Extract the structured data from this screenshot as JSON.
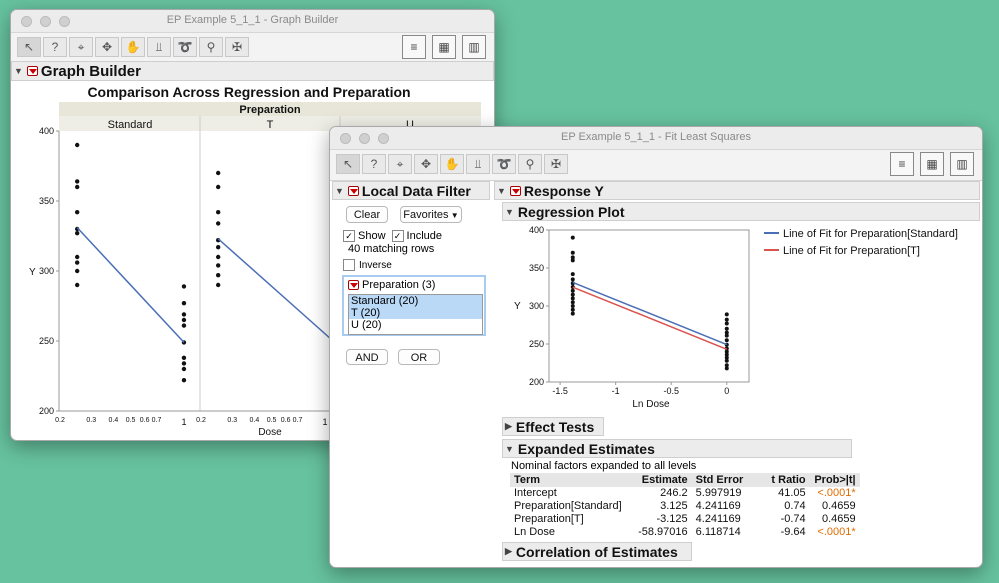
{
  "window1": {
    "title": "EP Example 5_1_1 - Graph Builder",
    "section_title": "Graph Builder",
    "chart_title": "Comparison Across Regression and Preparation",
    "group_header": "Preparation",
    "panels": [
      "Standard",
      "T",
      "U"
    ],
    "y_label": "Y",
    "x_label": "Dose"
  },
  "window2": {
    "title": "EP Example 5_1_1 - Fit Least Squares",
    "filter": {
      "title": "Local Data Filter",
      "clear_label": "Clear",
      "favorites_label": "Favorites",
      "show_label": "Show",
      "include_label": "Include",
      "matching_rows": "40 matching rows",
      "inverse_label": "Inverse",
      "column_label": "Preparation (3)",
      "levels": [
        "Standard (20)",
        "T (20)",
        "U (20)"
      ],
      "and_label": "AND",
      "or_label": "OR"
    },
    "response_title": "Response Y",
    "regression_title": "Regression Plot",
    "legend": [
      "Line of Fit for Preparation[Standard]",
      "Line of Fit for Preparation[T]"
    ],
    "plot_y_label": "Y",
    "plot_x_label": "Ln Dose",
    "effect_tests": "Effect Tests",
    "expanded_title": "Expanded Estimates",
    "expanded_note": "Nominal factors expanded to all levels",
    "table": {
      "headers": [
        "Term",
        "Estimate",
        "Std Error",
        "t Ratio",
        "Prob>|t|"
      ],
      "rows": [
        [
          "Intercept",
          "246.2",
          "5.997919",
          "41.05",
          "<.0001*"
        ],
        [
          "Preparation[Standard]",
          "3.125",
          "4.241169",
          "0.74",
          "0.4659"
        ],
        [
          "Preparation[T]",
          "-3.125",
          "4.241169",
          "-0.74",
          "0.4659"
        ],
        [
          "Ln Dose",
          "-58.97016",
          "6.118714",
          "-9.64",
          "<.0001*"
        ]
      ]
    },
    "correlation_title": "Correlation of Estimates"
  },
  "colors": {
    "standard_line": "#4a6fb5",
    "t_line": "#d9534f",
    "selection": "#b9d9f7",
    "significant": "#e06c00"
  },
  "chart_data": [
    {
      "type": "scatter",
      "title": "Comparison Across Regression and Preparation",
      "xlabel": "Dose",
      "ylabel": "Y",
      "xscale": "log",
      "xlim": [
        0.2,
        1.2
      ],
      "ylim": [
        200,
        400
      ],
      "x_ticks": [
        "0.2",
        "0.3",
        "0.4",
        "0.5",
        "0.6",
        "0.7",
        "1"
      ],
      "y_ticks": [
        200,
        250,
        300,
        350,
        400
      ],
      "panels": [
        {
          "name": "Standard",
          "points": [
            [
              0.25,
              390
            ],
            [
              0.25,
              364
            ],
            [
              0.25,
              360
            ],
            [
              0.25,
              342
            ],
            [
              0.25,
              330
            ],
            [
              0.25,
              327
            ],
            [
              0.25,
              310
            ],
            [
              0.25,
              306
            ],
            [
              0.25,
              300
            ],
            [
              0.25,
              290
            ],
            [
              1,
              289
            ],
            [
              1,
              277
            ],
            [
              1,
              269
            ],
            [
              1,
              265
            ],
            [
              1,
              261
            ],
            [
              1,
              249
            ],
            [
              1,
              238
            ],
            [
              1,
              234
            ],
            [
              1,
              230
            ],
            [
              1,
              222
            ]
          ],
          "fit": [
            [
              0.25,
              331
            ],
            [
              1,
              249
            ]
          ]
        },
        {
          "name": "T",
          "points": [
            [
              0.25,
              370
            ],
            [
              0.25,
              360
            ],
            [
              0.25,
              342
            ],
            [
              0.25,
              334
            ],
            [
              0.25,
              322
            ],
            [
              0.25,
              317
            ],
            [
              0.25,
              310
            ],
            [
              0.25,
              304
            ],
            [
              0.25,
              297
            ],
            [
              0.25,
              290
            ]
          ]
        }
      ]
    },
    {
      "type": "scatter",
      "title": "Regression Plot",
      "xlabel": "Ln Dose",
      "ylabel": "Y",
      "xlim": [
        -1.6,
        0.2
      ],
      "ylim": [
        200,
        400
      ],
      "x_ticks": [
        -1.5,
        -1,
        -0.5,
        0
      ],
      "y_ticks": [
        200,
        250,
        300,
        350,
        400
      ],
      "series": [
        {
          "name": "Line of Fit for Preparation[Standard]",
          "line": [
            [
              -1.386,
              331.05
            ],
            [
              0,
              249.33
            ]
          ]
        },
        {
          "name": "Line of Fit for Preparation[T]",
          "line": [
            [
              -1.386,
              324.8
            ],
            [
              0,
              243.08
            ]
          ]
        }
      ],
      "points": [
        [
          -1.386,
          390
        ],
        [
          -1.386,
          370
        ],
        [
          -1.386,
          364
        ],
        [
          -1.386,
          360
        ],
        [
          -1.386,
          342
        ],
        [
          -1.386,
          335
        ],
        [
          -1.386,
          330
        ],
        [
          -1.386,
          325
        ],
        [
          -1.386,
          320
        ],
        [
          -1.386,
          315
        ],
        [
          -1.386,
          310
        ],
        [
          -1.386,
          305
        ],
        [
          -1.386,
          300
        ],
        [
          -1.386,
          295
        ],
        [
          -1.386,
          290
        ],
        [
          0,
          289
        ],
        [
          0,
          282
        ],
        [
          0,
          277
        ],
        [
          0,
          270
        ],
        [
          0,
          265
        ],
        [
          0,
          261
        ],
        [
          0,
          255
        ],
        [
          0,
          249
        ],
        [
          0,
          244
        ],
        [
          0,
          240
        ],
        [
          0,
          236
        ],
        [
          0,
          232
        ],
        [
          0,
          228
        ],
        [
          0,
          222
        ],
        [
          0,
          218
        ]
      ]
    }
  ]
}
